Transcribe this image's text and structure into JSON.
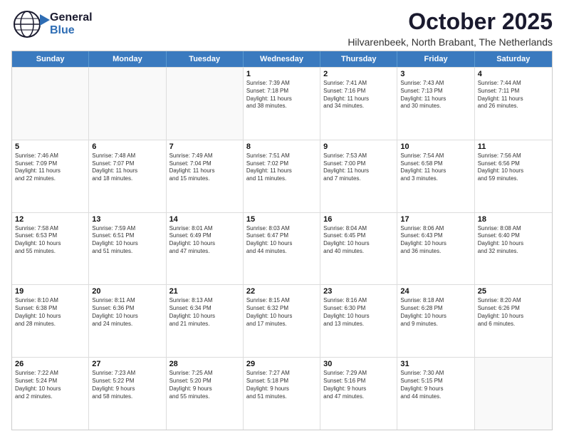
{
  "logo": {
    "line1": "General",
    "line2": "Blue"
  },
  "title": "October 2025",
  "subtitle": "Hilvarenbeek, North Brabant, The Netherlands",
  "days_of_week": [
    "Sunday",
    "Monday",
    "Tuesday",
    "Wednesday",
    "Thursday",
    "Friday",
    "Saturday"
  ],
  "weeks": [
    [
      {
        "day": "",
        "info": ""
      },
      {
        "day": "",
        "info": ""
      },
      {
        "day": "",
        "info": ""
      },
      {
        "day": "1",
        "info": "Sunrise: 7:39 AM\nSunset: 7:18 PM\nDaylight: 11 hours\nand 38 minutes."
      },
      {
        "day": "2",
        "info": "Sunrise: 7:41 AM\nSunset: 7:16 PM\nDaylight: 11 hours\nand 34 minutes."
      },
      {
        "day": "3",
        "info": "Sunrise: 7:43 AM\nSunset: 7:13 PM\nDaylight: 11 hours\nand 30 minutes."
      },
      {
        "day": "4",
        "info": "Sunrise: 7:44 AM\nSunset: 7:11 PM\nDaylight: 11 hours\nand 26 minutes."
      }
    ],
    [
      {
        "day": "5",
        "info": "Sunrise: 7:46 AM\nSunset: 7:09 PM\nDaylight: 11 hours\nand 22 minutes."
      },
      {
        "day": "6",
        "info": "Sunrise: 7:48 AM\nSunset: 7:07 PM\nDaylight: 11 hours\nand 18 minutes."
      },
      {
        "day": "7",
        "info": "Sunrise: 7:49 AM\nSunset: 7:04 PM\nDaylight: 11 hours\nand 15 minutes."
      },
      {
        "day": "8",
        "info": "Sunrise: 7:51 AM\nSunset: 7:02 PM\nDaylight: 11 hours\nand 11 minutes."
      },
      {
        "day": "9",
        "info": "Sunrise: 7:53 AM\nSunset: 7:00 PM\nDaylight: 11 hours\nand 7 minutes."
      },
      {
        "day": "10",
        "info": "Sunrise: 7:54 AM\nSunset: 6:58 PM\nDaylight: 11 hours\nand 3 minutes."
      },
      {
        "day": "11",
        "info": "Sunrise: 7:56 AM\nSunset: 6:56 PM\nDaylight: 10 hours\nand 59 minutes."
      }
    ],
    [
      {
        "day": "12",
        "info": "Sunrise: 7:58 AM\nSunset: 6:53 PM\nDaylight: 10 hours\nand 55 minutes."
      },
      {
        "day": "13",
        "info": "Sunrise: 7:59 AM\nSunset: 6:51 PM\nDaylight: 10 hours\nand 51 minutes."
      },
      {
        "day": "14",
        "info": "Sunrise: 8:01 AM\nSunset: 6:49 PM\nDaylight: 10 hours\nand 47 minutes."
      },
      {
        "day": "15",
        "info": "Sunrise: 8:03 AM\nSunset: 6:47 PM\nDaylight: 10 hours\nand 44 minutes."
      },
      {
        "day": "16",
        "info": "Sunrise: 8:04 AM\nSunset: 6:45 PM\nDaylight: 10 hours\nand 40 minutes."
      },
      {
        "day": "17",
        "info": "Sunrise: 8:06 AM\nSunset: 6:43 PM\nDaylight: 10 hours\nand 36 minutes."
      },
      {
        "day": "18",
        "info": "Sunrise: 8:08 AM\nSunset: 6:40 PM\nDaylight: 10 hours\nand 32 minutes."
      }
    ],
    [
      {
        "day": "19",
        "info": "Sunrise: 8:10 AM\nSunset: 6:38 PM\nDaylight: 10 hours\nand 28 minutes."
      },
      {
        "day": "20",
        "info": "Sunrise: 8:11 AM\nSunset: 6:36 PM\nDaylight: 10 hours\nand 24 minutes."
      },
      {
        "day": "21",
        "info": "Sunrise: 8:13 AM\nSunset: 6:34 PM\nDaylight: 10 hours\nand 21 minutes."
      },
      {
        "day": "22",
        "info": "Sunrise: 8:15 AM\nSunset: 6:32 PM\nDaylight: 10 hours\nand 17 minutes."
      },
      {
        "day": "23",
        "info": "Sunrise: 8:16 AM\nSunset: 6:30 PM\nDaylight: 10 hours\nand 13 minutes."
      },
      {
        "day": "24",
        "info": "Sunrise: 8:18 AM\nSunset: 6:28 PM\nDaylight: 10 hours\nand 9 minutes."
      },
      {
        "day": "25",
        "info": "Sunrise: 8:20 AM\nSunset: 6:26 PM\nDaylight: 10 hours\nand 6 minutes."
      }
    ],
    [
      {
        "day": "26",
        "info": "Sunrise: 7:22 AM\nSunset: 5:24 PM\nDaylight: 10 hours\nand 2 minutes."
      },
      {
        "day": "27",
        "info": "Sunrise: 7:23 AM\nSunset: 5:22 PM\nDaylight: 9 hours\nand 58 minutes."
      },
      {
        "day": "28",
        "info": "Sunrise: 7:25 AM\nSunset: 5:20 PM\nDaylight: 9 hours\nand 55 minutes."
      },
      {
        "day": "29",
        "info": "Sunrise: 7:27 AM\nSunset: 5:18 PM\nDaylight: 9 hours\nand 51 minutes."
      },
      {
        "day": "30",
        "info": "Sunrise: 7:29 AM\nSunset: 5:16 PM\nDaylight: 9 hours\nand 47 minutes."
      },
      {
        "day": "31",
        "info": "Sunrise: 7:30 AM\nSunset: 5:15 PM\nDaylight: 9 hours\nand 44 minutes."
      },
      {
        "day": "",
        "info": ""
      }
    ]
  ]
}
